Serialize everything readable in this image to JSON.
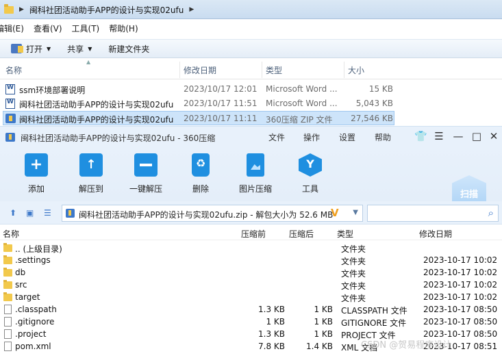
{
  "explorer": {
    "address": {
      "path": "闽科社团活动助手APP的设计与实现02ufu"
    },
    "menu": [
      "编辑(E)",
      "查看(V)",
      "工具(T)",
      "帮助(H)"
    ],
    "toolbar": {
      "open": "打开",
      "share": "共享",
      "new_folder": "新建文件夹"
    },
    "columns": {
      "name": "名称",
      "date": "修改日期",
      "type": "类型",
      "size": "大小"
    },
    "files": [
      {
        "name": "ssm环境部署说明",
        "date": "2023/10/17 12:01",
        "type": "Microsoft Word ...",
        "size": "15 KB",
        "icon": "word-doc-icon"
      },
      {
        "name": "闽科社团活动助手APP的设计与实现02ufu",
        "date": "2023/10/17 11:51",
        "type": "Microsoft Word ...",
        "size": "5,043 KB",
        "icon": "word-doc-icon"
      },
      {
        "name": "闽科社团活动助手APP的设计与实现02ufu",
        "date": "2023/10/17 11:11",
        "type": "360压缩 ZIP 文件",
        "size": "27,546 KB",
        "icon": "zip-icon",
        "selected": true
      }
    ]
  },
  "zipapp": {
    "title": "闽科社团活动助手APP的设计与实现02ufu - 360压缩",
    "menu": {
      "file": "文件",
      "ops": "操作",
      "settings": "设置",
      "help": "帮助"
    },
    "tools": {
      "add": "添加",
      "extract": "解压到",
      "onekey": "一键解压",
      "delete": "删除",
      "img": "图片压缩",
      "tools": "工具"
    },
    "scan": "扫描",
    "path": "闽科社团活动助手APP的设计与实现02ufu.zip - 解包大小为 52.6 MB",
    "columns": {
      "name": "名称",
      "before": "压缩前",
      "after": "压缩后",
      "type": "类型",
      "date": "修改日期"
    },
    "files": [
      {
        "name": ".. (上级目录)",
        "before": "",
        "after": "",
        "type": "文件夹",
        "date": "",
        "kind": "folder"
      },
      {
        "name": ".settings",
        "before": "",
        "after": "",
        "type": "文件夹",
        "date": "2023-10-17 10:02",
        "kind": "folder"
      },
      {
        "name": "db",
        "before": "",
        "after": "",
        "type": "文件夹",
        "date": "2023-10-17 10:02",
        "kind": "folder"
      },
      {
        "name": "src",
        "before": "",
        "after": "",
        "type": "文件夹",
        "date": "2023-10-17 10:02",
        "kind": "folder"
      },
      {
        "name": "target",
        "before": "",
        "after": "",
        "type": "文件夹",
        "date": "2023-10-17 10:02",
        "kind": "folder"
      },
      {
        "name": ".classpath",
        "before": "1.3 KB",
        "after": "1 KB",
        "type": "CLASSPATH 文件",
        "date": "2023-10-17 08:50",
        "kind": "file"
      },
      {
        "name": ".gitignore",
        "before": "1 KB",
        "after": "1 KB",
        "type": "GITIGNORE 文件",
        "date": "2023-10-17 08:50",
        "kind": "file"
      },
      {
        "name": ".project",
        "before": "1.3 KB",
        "after": "1 KB",
        "type": "PROJECT 文件",
        "date": "2023-10-17 08:50",
        "kind": "file"
      },
      {
        "name": "pom.xml",
        "before": "7.8 KB",
        "after": "1.4 KB",
        "type": "XML 文档",
        "date": "2023-10-17 08:51",
        "kind": "file"
      }
    ]
  },
  "watermark": "CSDN @贺易程序设计"
}
